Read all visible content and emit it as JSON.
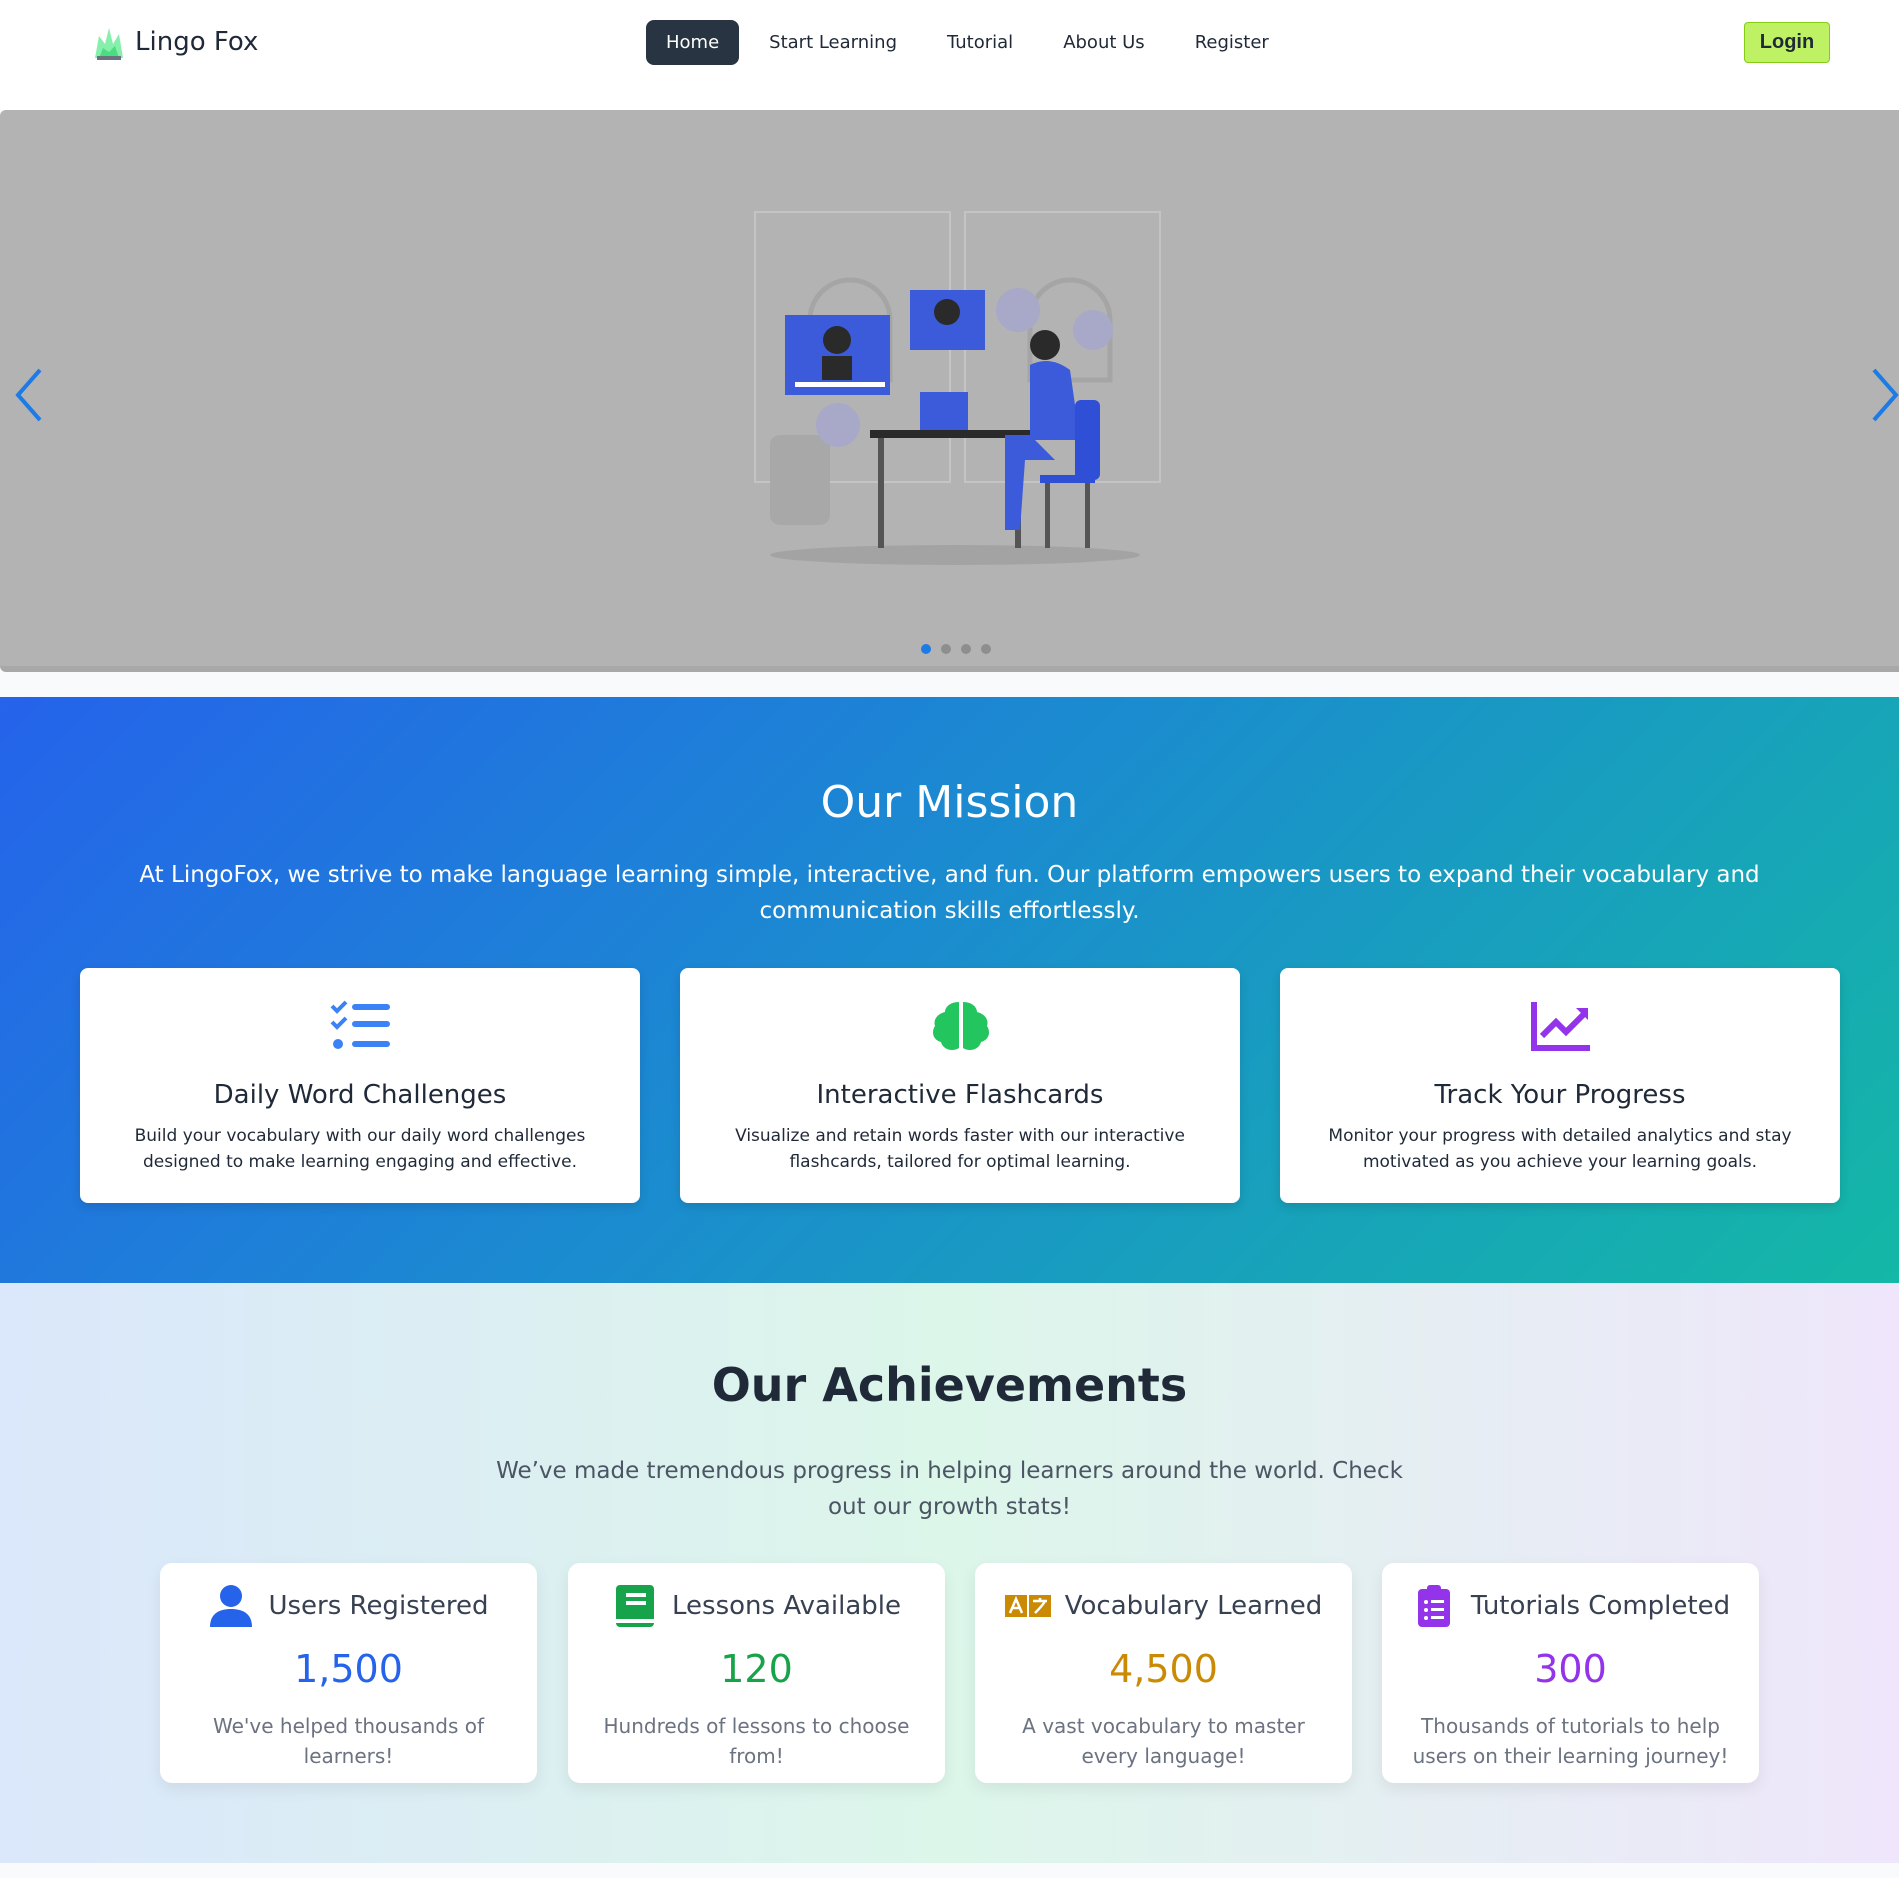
{
  "brand": {
    "name": "Lingo Fox"
  },
  "nav": {
    "items": [
      {
        "label": "Home",
        "active": true
      },
      {
        "label": "Start Learning"
      },
      {
        "label": "Tutorial"
      },
      {
        "label": "About Us"
      },
      {
        "label": "Register"
      }
    ],
    "login_label": "Login"
  },
  "carousel": {
    "slide_count": 4,
    "active_slide": 1
  },
  "mission": {
    "title": "Our Mission",
    "text": "At LingoFox, we strive to make language learning simple, interactive, and fun. Our platform empowers users to expand their vocabulary and communication skills effortlessly.",
    "features": [
      {
        "icon": "checklist-icon",
        "title": "Daily Word Challenges",
        "desc": "Build your vocabulary with our daily word challenges designed to make learning engaging and effective."
      },
      {
        "icon": "brain-icon",
        "title": "Interactive Flashcards",
        "desc": "Visualize and retain words faster with our interactive flashcards, tailored for optimal learning."
      },
      {
        "icon": "chart-line-icon",
        "title": "Track Your Progress",
        "desc": "Monitor your progress with detailed analytics and stay motivated as you achieve your learning goals."
      }
    ]
  },
  "achievements": {
    "title": "Our Achievements",
    "subtitle": "We’ve made tremendous progress in helping learners around the world. Check out our growth stats!",
    "stats": [
      {
        "icon": "user-icon",
        "label": "Users Registered",
        "value": "1,500",
        "desc": "We've helped thousands of learners!",
        "color": "#2563eb"
      },
      {
        "icon": "book-icon",
        "label": "Lessons Available",
        "value": "120",
        "desc": "Hundreds of lessons to choose from!",
        "color": "#16a34a"
      },
      {
        "icon": "translate-icon",
        "label": "Vocabulary Learned",
        "value": "4,500",
        "desc": "A vast vocabulary to master every language!",
        "color": "#ca8a04"
      },
      {
        "icon": "clipboard-list-icon",
        "label": "Tutorials Completed",
        "value": "300",
        "desc": "Thousands of tutorials to help users on their learning journey!",
        "color": "#9333ea"
      }
    ]
  },
  "colors": {
    "accent": "#283441",
    "login": "#bef264",
    "mission_start": "#2563eb",
    "mission_end": "#14b8a6"
  }
}
